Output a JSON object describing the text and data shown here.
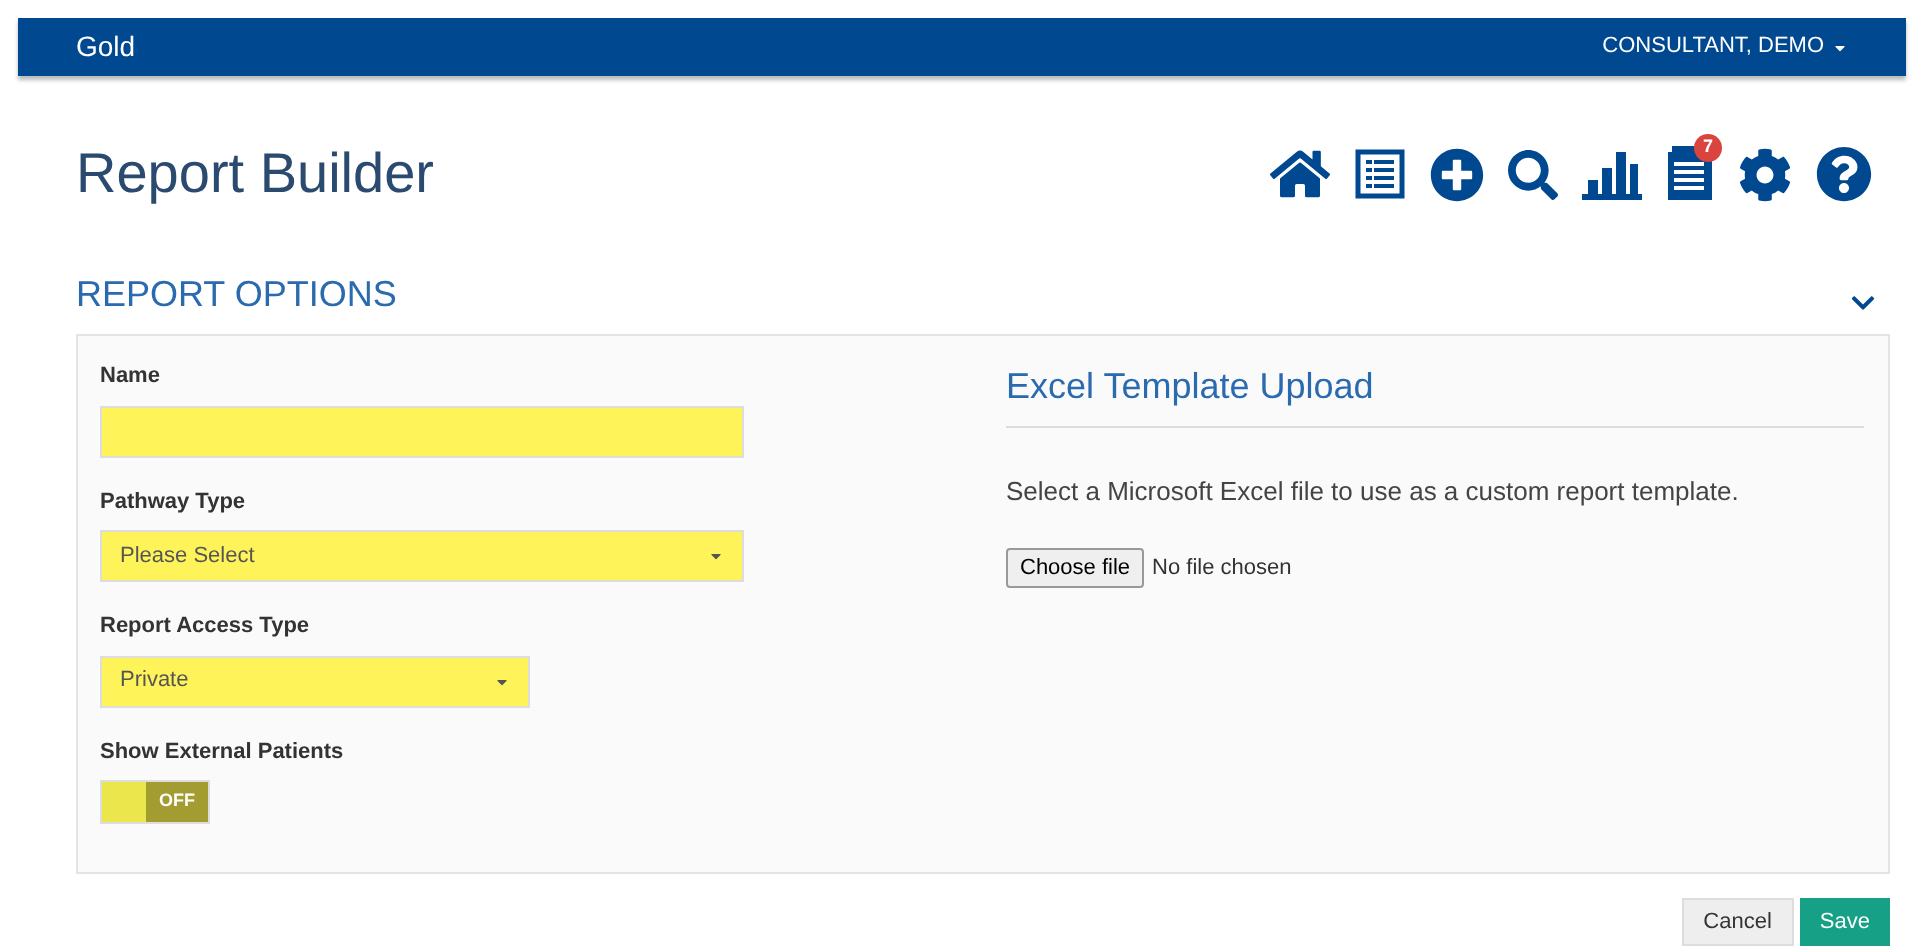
{
  "header": {
    "brand": "Gold",
    "user_menu": "CONSULTANT, DEMO"
  },
  "page_title": "Report Builder",
  "toolbar": {
    "notification_badge": "7"
  },
  "section": {
    "title": "REPORT OPTIONS",
    "expanded": true
  },
  "form": {
    "fields": [
      {
        "kind": "text",
        "label": "Name"
      },
      {
        "kind": "select",
        "label": "Pathway Type",
        "value": "Please Select",
        "wide": true
      },
      {
        "kind": "select",
        "label": "Report Access Type",
        "value": "Private",
        "wide": false
      },
      {
        "kind": "toggle",
        "label": "Show External Patients",
        "on": false,
        "state_text": "OFF"
      }
    ]
  },
  "upload": {
    "title": "Excel Template Upload",
    "description": "Select a Microsoft Excel file to use as a custom report template.",
    "button": "Choose file",
    "status": "No file chosen"
  },
  "actions": [
    {
      "label": "Cancel",
      "kind": "secondary"
    },
    {
      "label": "Save",
      "kind": "primary"
    }
  ]
}
